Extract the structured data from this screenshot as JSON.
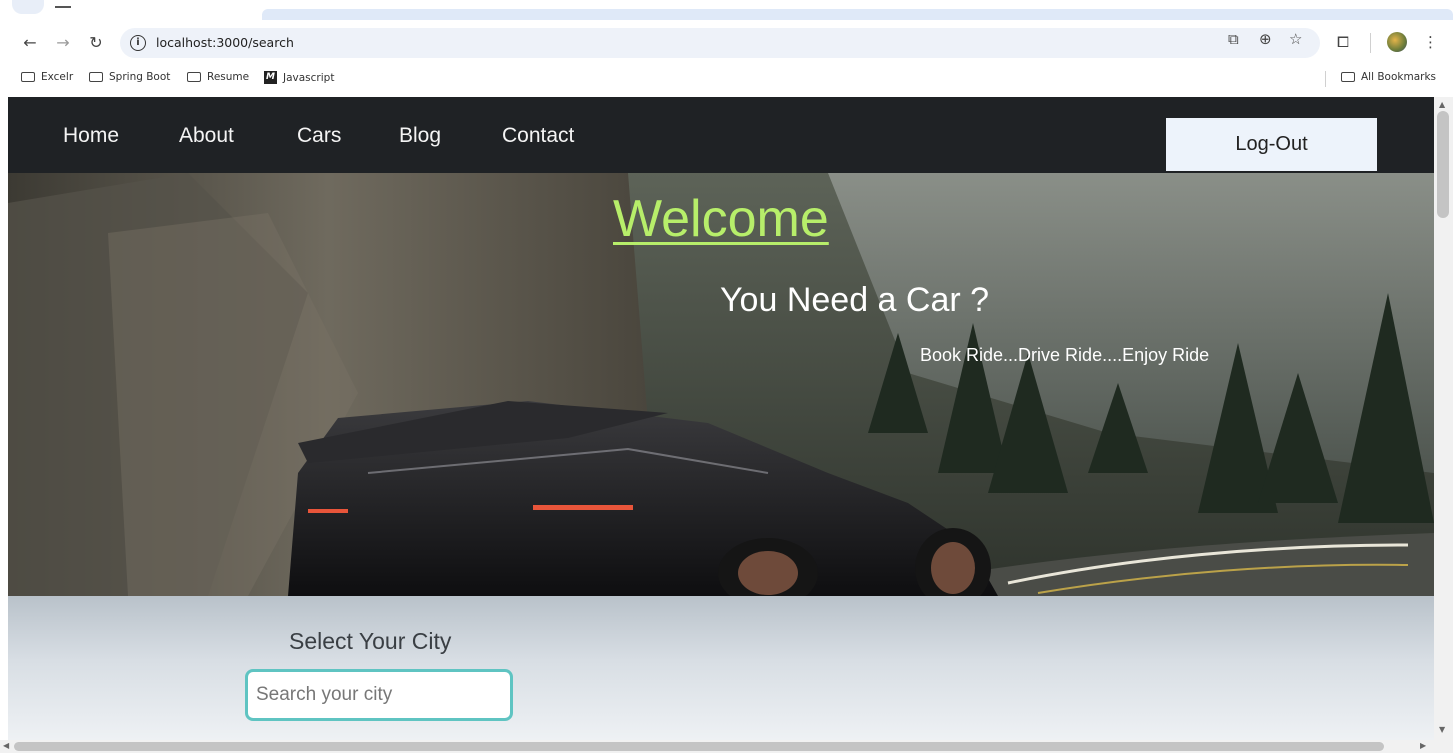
{
  "browser": {
    "url": "localhost:3000/search",
    "bookmarks": [
      "Excelr",
      "Spring Boot",
      "Resume",
      "Javascript"
    ],
    "all_bookmarks_label": "All Bookmarks"
  },
  "navbar": {
    "links": [
      "Home",
      "About",
      "Cars",
      "Blog",
      "Contact"
    ],
    "logout_label": "Log-Out"
  },
  "hero": {
    "welcome": "Welcome",
    "headline": "You Need a Car ?",
    "tagline": "Book Ride...Drive Ride....Enjoy Ride"
  },
  "city_search": {
    "title": "Select Your City",
    "placeholder": "Search your city",
    "value": ""
  },
  "colors": {
    "navbar_bg": "#1f2225",
    "welcome_accent": "#b7ee6a",
    "input_border": "#5fc4c2",
    "logout_bg": "#edf3fb"
  }
}
